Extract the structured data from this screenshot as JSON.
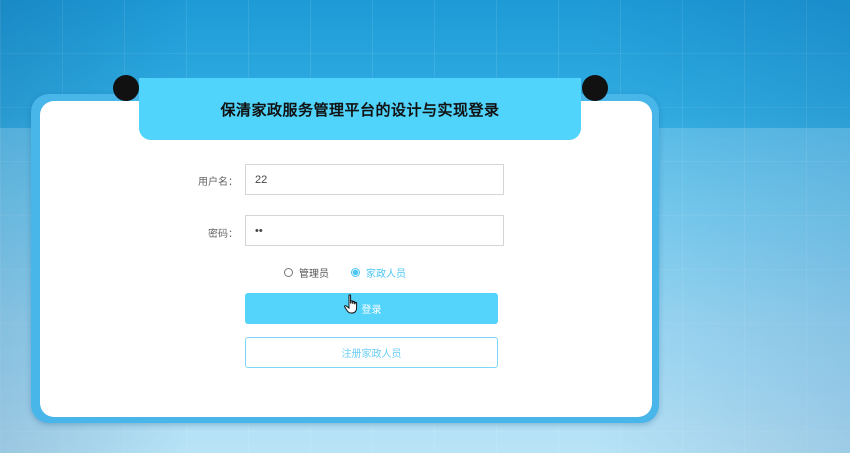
{
  "page": {
    "title": "保清家政服务管理平台的设计与实现登录"
  },
  "form": {
    "username_label": "用户名：",
    "username_value": "22",
    "password_label": "密码：",
    "password_value": "••",
    "roles": [
      {
        "label": "管理员",
        "selected": false
      },
      {
        "label": "家政人员",
        "selected": true
      }
    ],
    "login_label": "登录",
    "register_label": "注册家政人员"
  },
  "colors": {
    "accent": "#50d4fb",
    "frame": "#49b6ea",
    "selected_role": "#4cc6f2"
  },
  "icons": {
    "cursor": "hand-pointer-icon"
  }
}
